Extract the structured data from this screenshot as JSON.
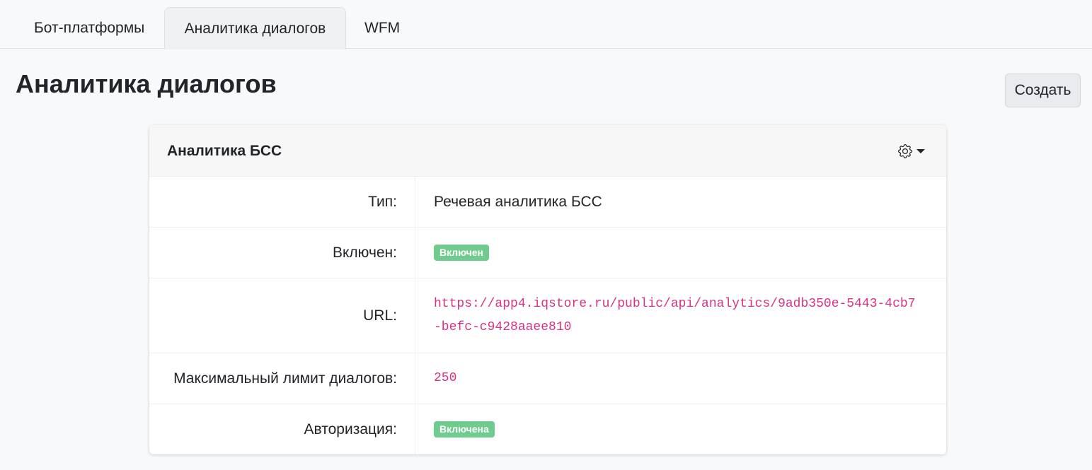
{
  "tabs": [
    {
      "label": "Бот-платформы",
      "active": false
    },
    {
      "label": "Аналитика диалогов",
      "active": true
    },
    {
      "label": "WFM",
      "active": false
    }
  ],
  "page": {
    "title": "Аналитика диалогов",
    "create_label": "Создать"
  },
  "card": {
    "title": "Аналитика БСС",
    "settings_icon": "gear-icon",
    "rows": [
      {
        "label": "Тип:",
        "value": "Речевая аналитика БСС"
      },
      {
        "label": "Включен:",
        "value": "Включен"
      },
      {
        "label": "URL:",
        "value": "https://app4.iqstore.ru/public/api/analytics/9adb350e-5443-4cb7-befc-c9428aaee810"
      },
      {
        "label": "Максимальный лимит диалогов:",
        "value": "250"
      },
      {
        "label": "Авторизация:",
        "value": "Включена"
      }
    ]
  },
  "colors": {
    "badge_success": "#6fcb8e",
    "code_text": "#d63384",
    "background": "#f8f9fb"
  }
}
